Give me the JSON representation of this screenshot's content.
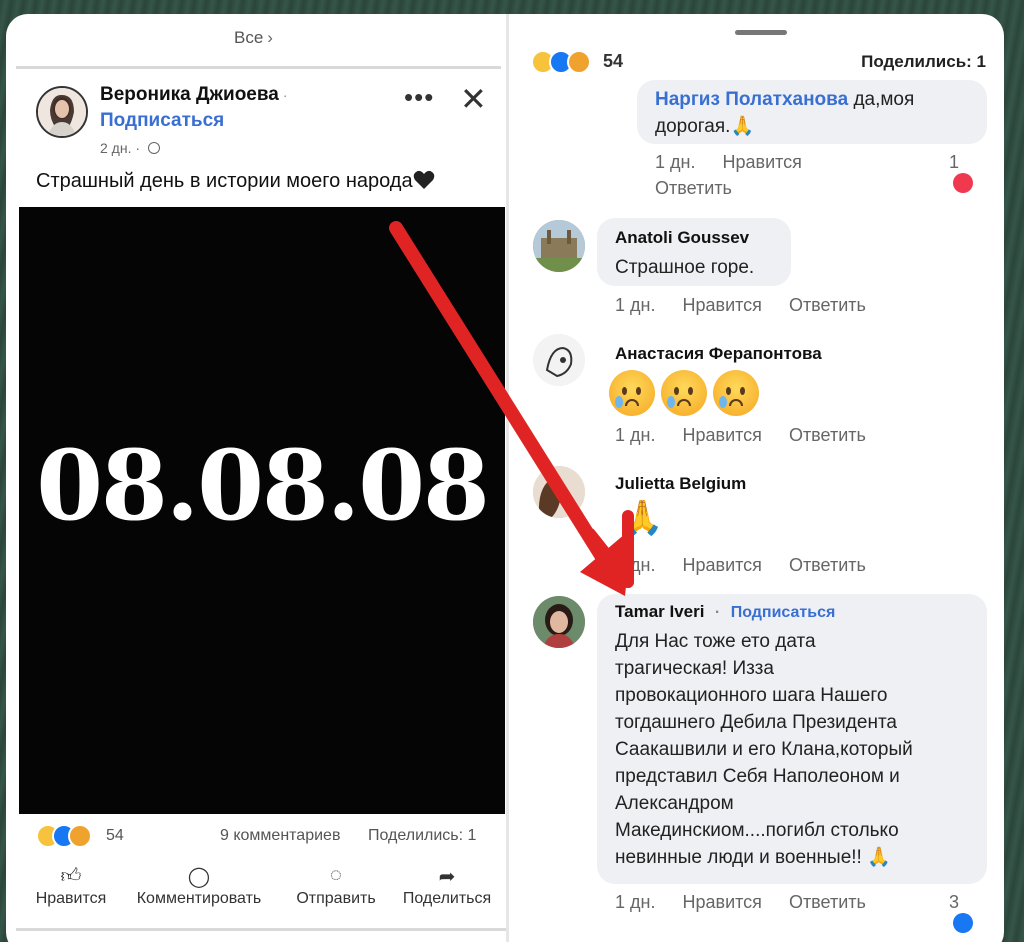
{
  "left": {
    "all_link": "Все",
    "author": "Вероника Джиоева",
    "follow": "Подписаться",
    "post_age": "2 дн.",
    "post_text": "Страшный день в истории моего народа",
    "image_text": "08.08.08",
    "reaction_count": "54",
    "comments": "9 комментариев",
    "shares": "Поделились: 1",
    "actions": [
      "Нравится",
      "Комментировать",
      "Отправить",
      "Поделиться"
    ]
  },
  "right": {
    "reaction_count": "54",
    "shares": "Поделились: 1",
    "comments": [
      {
        "name": "Наргиз Полатханова",
        "text_inline": "да,моя",
        "text2": "дорогая.",
        "age": "1 дн.",
        "like": "Нравится",
        "reply": "Ответить",
        "reactions": "1"
      },
      {
        "name": "Anatoli Goussev",
        "text": "Страшное  горе.",
        "age": "1 дн.",
        "like": "Нравится",
        "reply": "Ответить"
      },
      {
        "name": "Анастасия Ферапонтова",
        "age": "1 дн.",
        "like": "Нравится",
        "reply": "Ответить"
      },
      {
        "name": "Julietta Belgium",
        "age": "1 дн.",
        "like": "Нравится",
        "reply": "Ответить"
      },
      {
        "name": "Tamar Iveri",
        "follow": "Подписаться",
        "lines": [
          "Для Нас тоже ето дата",
          "трагическая! Изза",
          "провокационного шага Нашего",
          "тогдашнего Дебила Президента",
          "Саакашвили и его Клана,который",
          "представил Себя Наполеоном и",
          "Александром",
          "Макединскиом....погибл столько",
          "невинные люди и военные!!"
        ],
        "age": "1 дн.",
        "like": "Нравится",
        "reply": "Ответить",
        "reactions": "3"
      }
    ]
  },
  "colors": {
    "link_blue": "#3a6fd2",
    "arrow_red": "#e02424",
    "bubble": "#eef0f3"
  }
}
